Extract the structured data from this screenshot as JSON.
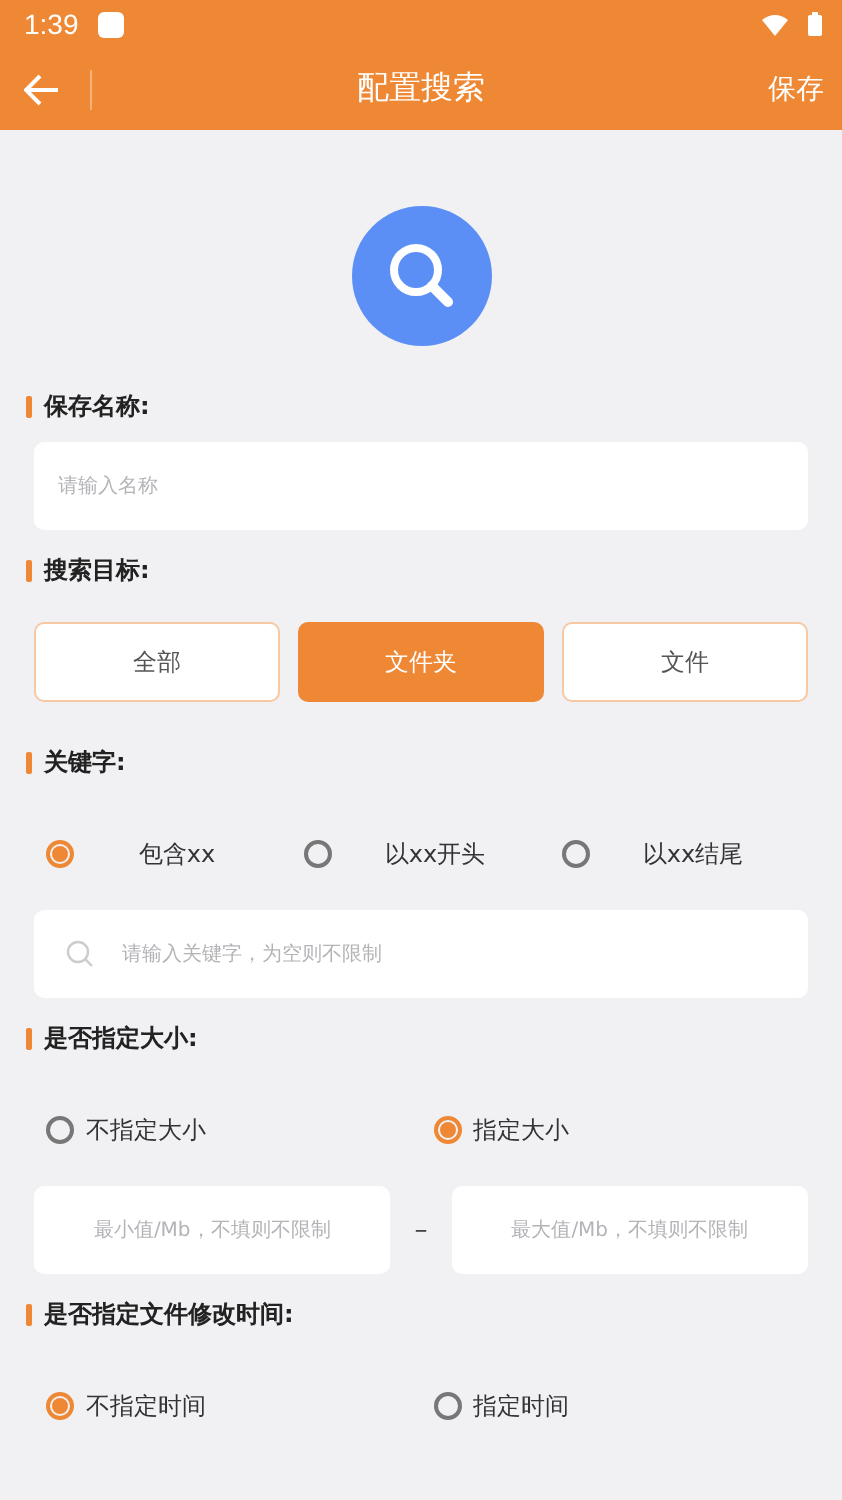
{
  "status_bar": {
    "time": "1:39"
  },
  "toolbar": {
    "title": "配置搜索",
    "action": "保存"
  },
  "sections": [
    {
      "kind": "name",
      "label": "保存名称:",
      "placeholder": "请输入名称"
    },
    {
      "kind": "target",
      "label": "搜索目标:",
      "options": [
        {
          "label": "全部",
          "selected": false
        },
        {
          "label": "文件夹",
          "selected": true
        },
        {
          "label": "文件",
          "selected": false
        }
      ]
    },
    {
      "kind": "keyword",
      "label": "关键字:",
      "options": [
        {
          "label": "包含xx",
          "selected": true
        },
        {
          "label": "以xx开头",
          "selected": false
        },
        {
          "label": "以xx结尾",
          "selected": false
        }
      ],
      "placeholder": "请输入关键字，为空则不限制"
    },
    {
      "kind": "size",
      "label": "是否指定大小:",
      "options": [
        {
          "label": "不指定大小",
          "selected": false
        },
        {
          "label": "指定大小",
          "selected": true
        }
      ],
      "min_placeholder": "最小值/Mb，不填则不限制",
      "separator": "–",
      "max_placeholder": "最大值/Mb，不填则不限制"
    },
    {
      "kind": "time",
      "label": "是否指定文件修改时间:",
      "options": [
        {
          "label": "不指定时间",
          "selected": true
        },
        {
          "label": "指定时间",
          "selected": false
        }
      ]
    }
  ]
}
